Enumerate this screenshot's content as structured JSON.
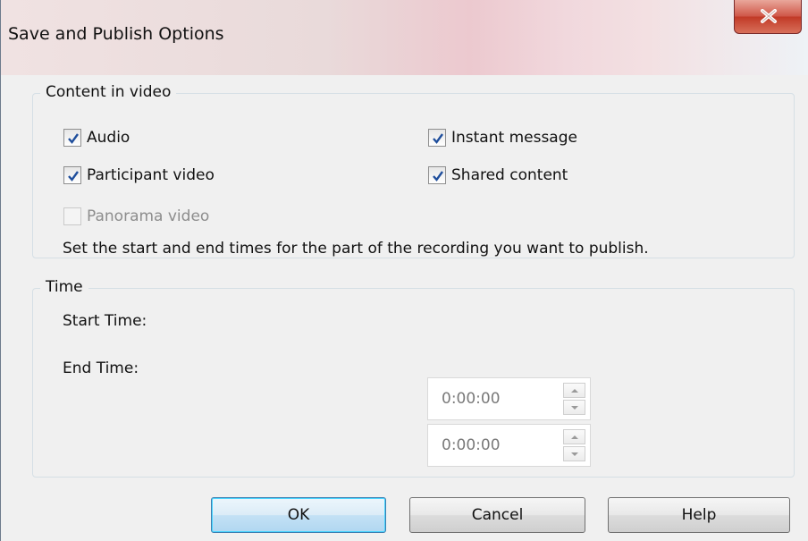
{
  "window": {
    "title": "Save and Publish Options",
    "close_label": "close"
  },
  "content_group": {
    "label": "Content in video",
    "options": [
      {
        "label": "Audio",
        "checked": true,
        "enabled": true
      },
      {
        "label": "Participant video",
        "checked": true,
        "enabled": true
      },
      {
        "label": "Panorama video",
        "checked": false,
        "enabled": false
      },
      {
        "label": "Instant message",
        "checked": true,
        "enabled": true
      },
      {
        "label": "Shared content",
        "checked": true,
        "enabled": true
      }
    ]
  },
  "time_group": {
    "label": "Time",
    "description": "Set the start and end times for the part of the recording you want to publish.",
    "start_label": "Start Time:",
    "start_value": "0:00:00",
    "end_label": "End Time:",
    "end_value": "0:00:00"
  },
  "buttons": {
    "ok": "OK",
    "cancel": "Cancel",
    "help": "Help"
  },
  "colors": {
    "close_button": "#c13a27",
    "default_button_border": "#3c7fb1",
    "check_mark": "#1f4e9c"
  }
}
